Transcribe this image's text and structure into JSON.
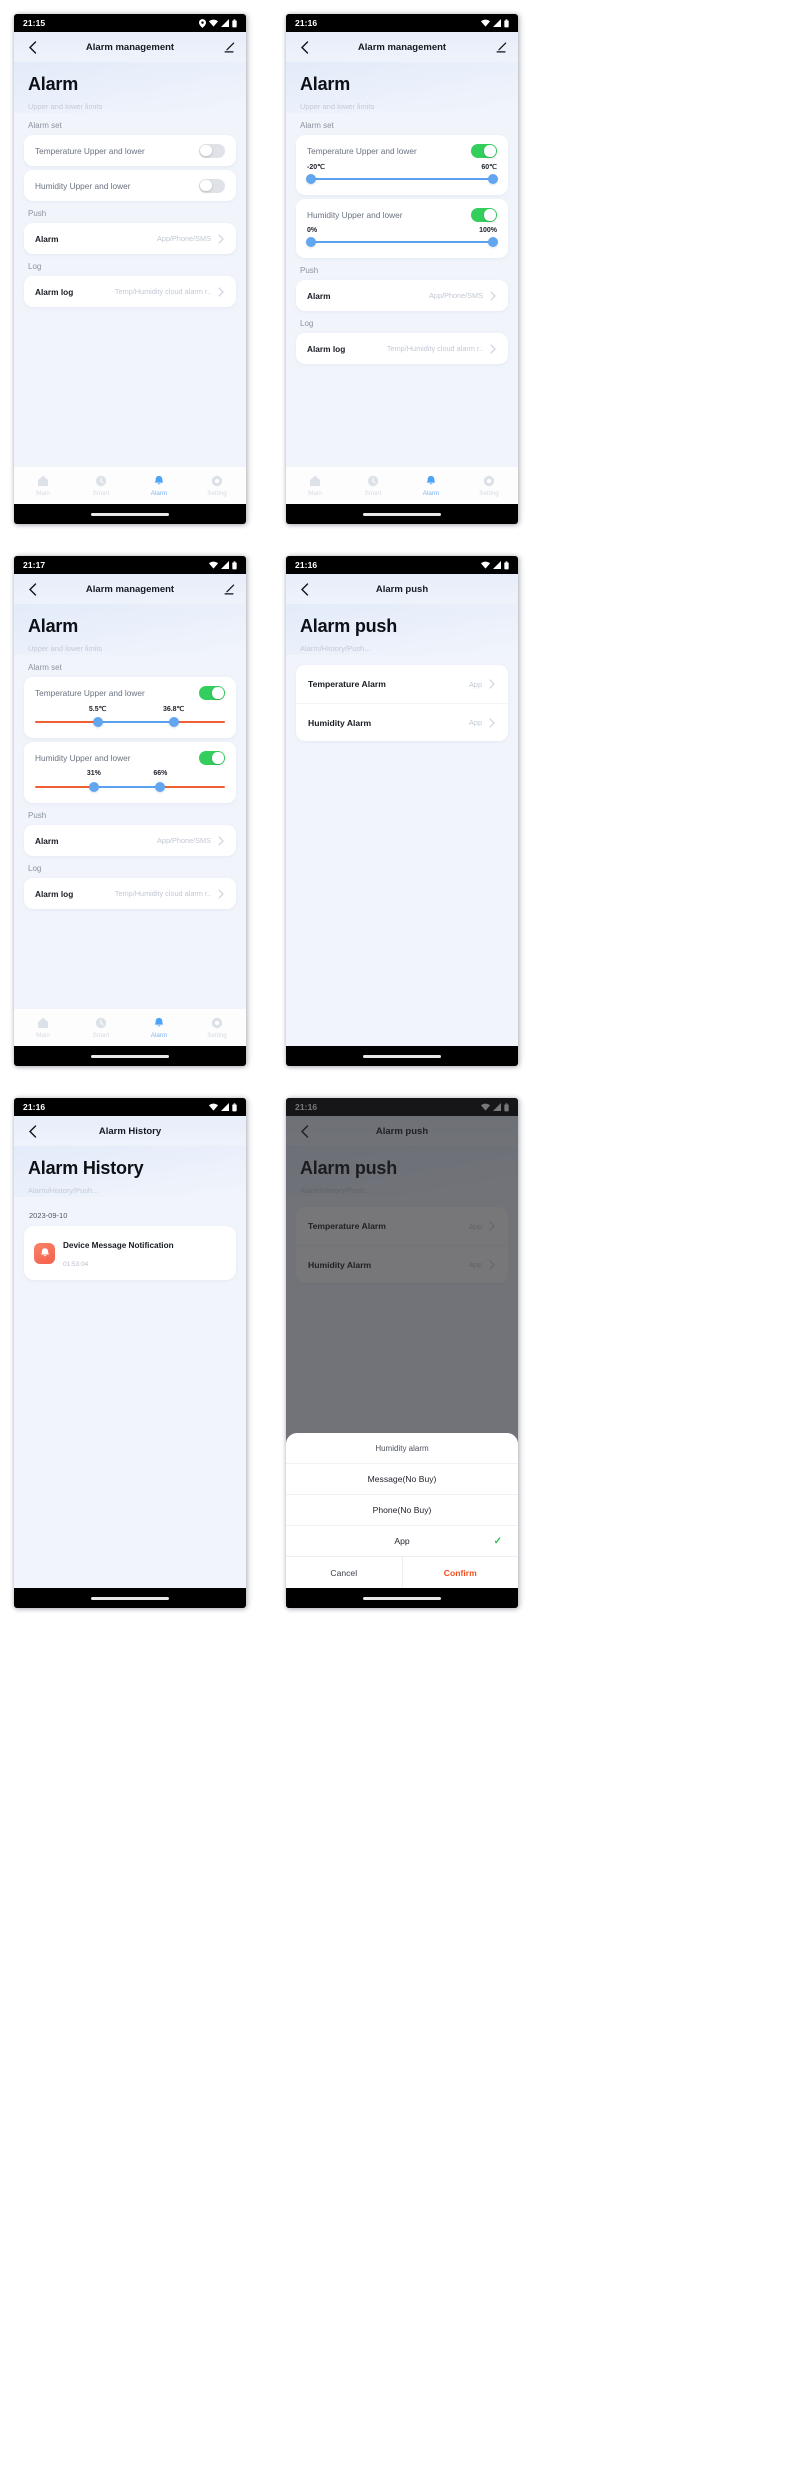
{
  "panels": [
    {
      "id": "alarm-management-off",
      "status": {
        "time": "21:15",
        "icons": [
          "location-icon",
          "wifi-icon",
          "signal-icon",
          "battery-icon"
        ]
      },
      "nav": {
        "title": "Alarm management",
        "back_icon": "chevron-left-icon",
        "edit_icon": "pencil-icon"
      },
      "hero": {
        "title": "Alarm",
        "subtitle": "Upper and lower limits"
      },
      "sections": {
        "alarm_set": "Alarm set",
        "push": "Push",
        "log": "Log"
      },
      "rows": {
        "temperature": {
          "label": "Temperature Upper and lower",
          "enabled": false
        },
        "humidity": {
          "label": "Humidity Upper and lower",
          "enabled": false
        },
        "alarm": {
          "label": "Alarm",
          "value": "App/Phone/SMS"
        },
        "alarm_log": {
          "label": "Alarm log",
          "value": "Temp/Humidity cloud alarm r.."
        }
      },
      "tabs": [
        {
          "label": "Main",
          "icon": "home-icon",
          "active": false
        },
        {
          "label": "Smart",
          "icon": "clock-icon",
          "active": false
        },
        {
          "label": "Alarm",
          "icon": "bell-icon",
          "active": true
        },
        {
          "label": "Setting",
          "icon": "gear-icon",
          "active": false
        }
      ]
    },
    {
      "id": "alarm-management-on-full",
      "status": {
        "time": "21:16",
        "icons": [
          "wifi-icon",
          "signal-icon",
          "battery-icon"
        ]
      },
      "nav": {
        "title": "Alarm management",
        "back_icon": "chevron-left-icon",
        "edit_icon": "pencil-icon"
      },
      "hero": {
        "title": "Alarm",
        "subtitle": "Upper and lower limits"
      },
      "sections": {
        "alarm_set": "Alarm set",
        "push": "Push",
        "log": "Log"
      },
      "rows": {
        "temperature": {
          "label": "Temperature Upper and lower",
          "enabled": true,
          "min": "-20℃",
          "max": "60℃"
        },
        "humidity": {
          "label": "Humidity Upper and lower",
          "enabled": true,
          "min": "0%",
          "max": "100%"
        },
        "alarm": {
          "label": "Alarm",
          "value": "App/Phone/SMS"
        },
        "alarm_log": {
          "label": "Alarm log",
          "value": "Temp/Humidity cloud alarm r.."
        }
      },
      "tabs": [
        {
          "label": "Main",
          "icon": "home-icon",
          "active": false
        },
        {
          "label": "Smart",
          "icon": "clock-icon",
          "active": false
        },
        {
          "label": "Alarm",
          "icon": "bell-icon",
          "active": true
        },
        {
          "label": "Setting",
          "icon": "gear-icon",
          "active": false
        }
      ]
    },
    {
      "id": "alarm-management-ranges",
      "status": {
        "time": "21:17",
        "icons": [
          "wifi-icon",
          "signal-icon",
          "battery-icon"
        ]
      },
      "nav": {
        "title": "Alarm management",
        "back_icon": "chevron-left-icon",
        "edit_icon": "pencil-icon"
      },
      "hero": {
        "title": "Alarm",
        "subtitle": "Upper and lower limits"
      },
      "sections": {
        "alarm_set": "Alarm set",
        "push": "Push",
        "log": "Log"
      },
      "rows": {
        "temperature": {
          "label": "Temperature Upper and lower",
          "enabled": true,
          "low": "5.5℃",
          "high": "36.8℃"
        },
        "humidity": {
          "label": "Humidity Upper and lower",
          "enabled": true,
          "low": "31%",
          "high": "66%"
        },
        "alarm": {
          "label": "Alarm",
          "value": "App/Phone/SMS"
        },
        "alarm_log": {
          "label": "Alarm log",
          "value": "Temp/Humidity cloud alarm r.."
        }
      },
      "tabs": [
        {
          "label": "Main",
          "icon": "home-icon",
          "active": false
        },
        {
          "label": "Smart",
          "icon": "clock-icon",
          "active": false
        },
        {
          "label": "Alarm",
          "icon": "bell-icon",
          "active": true
        },
        {
          "label": "Setting",
          "icon": "gear-icon",
          "active": false
        }
      ]
    },
    {
      "id": "alarm-push",
      "status": {
        "time": "21:16",
        "icons": [
          "wifi-icon",
          "signal-icon",
          "battery-icon"
        ]
      },
      "nav": {
        "title": "Alarm push",
        "back_icon": "chevron-left-icon"
      },
      "hero": {
        "title": "Alarm push",
        "subtitle": "Alarm/History/Push..."
      },
      "items": [
        {
          "label": "Temperature Alarm",
          "value": "App"
        },
        {
          "label": "Humidity Alarm",
          "value": "App"
        }
      ]
    },
    {
      "id": "alarm-history",
      "status": {
        "time": "21:16",
        "icons": [
          "wifi-icon",
          "signal-icon",
          "battery-icon"
        ]
      },
      "nav": {
        "title": "Alarm History",
        "back_icon": "chevron-left-icon"
      },
      "hero": {
        "title": "Alarm History",
        "subtitle": "Alarm/History/Push..."
      },
      "date": "2023-09-10",
      "entry": {
        "title": "Device Message Notification",
        "time": "01:53:04",
        "icon": "alarm-bell-icon"
      }
    },
    {
      "id": "alarm-push-sheet",
      "status": {
        "time": "21:16",
        "icons": [
          "wifi-icon",
          "signal-icon",
          "battery-icon"
        ]
      },
      "nav": {
        "title": "Alarm push",
        "back_icon": "chevron-left-icon"
      },
      "hero": {
        "title": "Alarm push",
        "subtitle": "Alarm/History/Push..."
      },
      "items": [
        {
          "label": "Temperature Alarm",
          "value": "App"
        },
        {
          "label": "Humidity Alarm",
          "value": "App"
        }
      ],
      "sheet": {
        "title": "Humidity alarm",
        "options": [
          {
            "label": "Message(No Buy)",
            "selected": false
          },
          {
            "label": "Phone(No Buy)",
            "selected": false
          },
          {
            "label": "App",
            "selected": true
          }
        ],
        "cancel": "Cancel",
        "confirm": "Confirm",
        "check_glyph": "✓"
      }
    }
  ],
  "colors": {
    "accent_blue": "#5aa2ef",
    "toggle_on": "#34ce5c",
    "orange": "#ef5f32",
    "confirm": "#f0501e",
    "page_bg": "#f1f5fb"
  }
}
